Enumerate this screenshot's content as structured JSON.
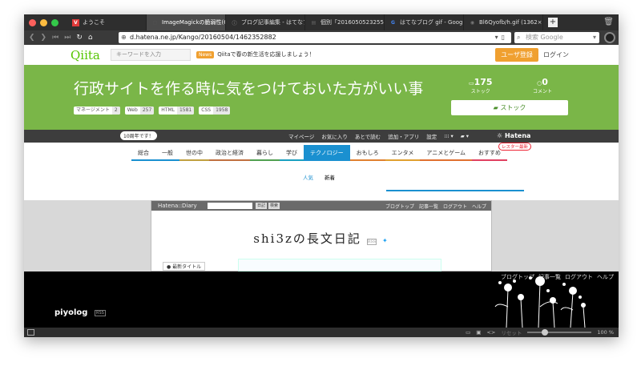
{
  "browser": {
    "tabs": [
      {
        "label": "ようこそ",
        "fav": "V",
        "fav_color": "#e03a3a",
        "active": false
      },
      {
        "label": "ImageMagickの脆弱性(CVE",
        "fav": "▢",
        "fav_color": "#555555",
        "active": true
      },
      {
        "label": "ブログ記事編集 - はてなブロ",
        "fav": "ⓘ",
        "fav_color": "#666666",
        "active": false
      },
      {
        "label": "個別「20160505232552」の",
        "fav": "▤",
        "fav_color": "#666666",
        "active": false
      },
      {
        "label": "はてなブログ gif - Google 検",
        "fav": "G",
        "fav_color": "#4285f4",
        "active": false
      },
      {
        "label": "Bl6Qyofb/h.gif (1362×740)",
        "fav": "◉",
        "fav_color": "#777777",
        "active": false
      }
    ],
    "new_tab": "+",
    "trash_icon": "trash-icon",
    "url": "d.hatena.ne.jp/Kango/20160504/1462352882",
    "search_placeholder": "検索 Google",
    "zoom": "100 %",
    "reset_label": "リセット"
  },
  "qiita": {
    "logo": "Qiita",
    "search_placeholder": "キーワードを入力",
    "news_badge": "News",
    "news_text": "Qiitaで春の新生活を応援しましょう！",
    "signup": "ユーザ登録",
    "login": "ログイン",
    "title": "行政サイトを作る時に気をつけておいた方がいい事",
    "stock_count": "175",
    "stock_label": "ストック",
    "comment_count": "0",
    "comment_label": "コメント",
    "stock_button": "ストック",
    "tags": [
      {
        "name": "マネージメント",
        "count": "2"
      },
      {
        "name": "Web",
        "count": "257"
      },
      {
        "name": "HTML",
        "count": "1581"
      },
      {
        "name": "CSS",
        "count": "1958"
      }
    ]
  },
  "hatena_bar": {
    "anniversary": "10周年です！",
    "links": [
      "マイページ",
      "お気に入り",
      "あとで読む",
      "追加・アプリ",
      "設定"
    ],
    "logo": "Hatena",
    "categories": [
      {
        "label": "総合",
        "color": "#1a90d0"
      },
      {
        "label": "一般",
        "color": "#1a90d0"
      },
      {
        "label": "世の中",
        "color": "#c0a040"
      },
      {
        "label": "政治と経済",
        "color": "#c07040"
      },
      {
        "label": "暮らし",
        "color": "#50a050"
      },
      {
        "label": "学び",
        "color": "#1aa0c0"
      },
      {
        "label": "テクノロジー",
        "color": "#1a90d0"
      },
      {
        "label": "おもしろ",
        "color": "#e08030"
      },
      {
        "label": "エンタメ",
        "color": "#e0a030"
      },
      {
        "label": "アニメとゲーム",
        "color": "#e07030"
      },
      {
        "label": "おすすめ",
        "color": "#e04060"
      }
    ],
    "lecture_badge": "レスター最新",
    "subtabs": [
      "人気",
      "新着"
    ]
  },
  "diary": {
    "brand": "Hatena::Diary",
    "buttons": [
      "日記",
      "検索"
    ],
    "links": [
      "ブログトップ",
      "記事一覧",
      "ログアウト",
      "ヘルプ"
    ],
    "title": "shi3zの長文日記",
    "rss": "RSS",
    "side_title": "最新タイトル"
  },
  "piyolog": {
    "name": "piyolog",
    "rss": "RSS",
    "links": [
      "ブログトップ",
      "記事一覧",
      "ログアウト",
      "ヘルプ"
    ]
  }
}
